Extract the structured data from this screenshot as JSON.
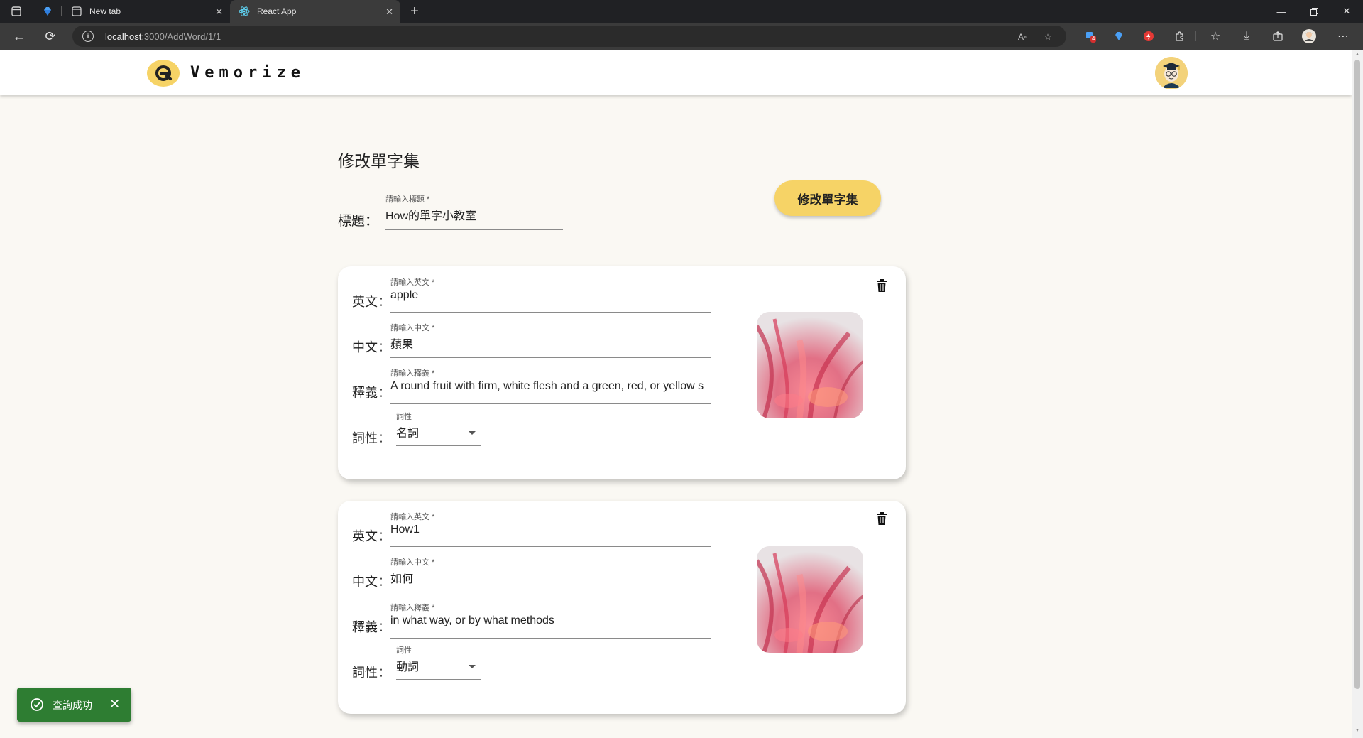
{
  "browser": {
    "tabs": [
      {
        "title": "New tab",
        "active": false
      },
      {
        "title": "React App",
        "active": true
      }
    ],
    "address": {
      "host": "localhost",
      "path": ":3000/AddWord/1/1"
    },
    "extension_badge": "4"
  },
  "app": {
    "brand": "Vemorize"
  },
  "page": {
    "title": "修改單字集",
    "set_title_label": "標題：",
    "set_title_field": {
      "label": "請輸入標題 *",
      "value": "How的單字小教室"
    },
    "submit_label": "修改單字集"
  },
  "labels": {
    "english": "英文：",
    "chinese": "中文：",
    "definition": "釋義：",
    "pos": "詞性："
  },
  "field_labels": {
    "english": "請輸入英文 *",
    "chinese": "請輸入中文 *",
    "definition": "請輸入釋義 *",
    "pos": "詞性"
  },
  "words": [
    {
      "english": "apple",
      "chinese": "蘋果",
      "definition": "A round fruit with firm, white flesh and a green, red, or yellow s",
      "pos": "名詞"
    },
    {
      "english": "How1",
      "chinese": "如何",
      "definition": "in what way, or by what methods",
      "pos": "動詞"
    }
  ],
  "toast": {
    "message": "查詢成功",
    "color": "#2e7d32"
  },
  "colors": {
    "accent": "#f6d366",
    "page_bg": "#faf8f3"
  }
}
